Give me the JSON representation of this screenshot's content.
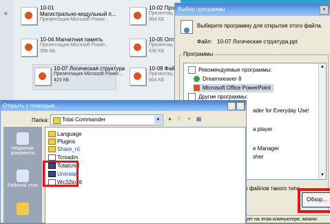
{
  "explorer": {
    "collapse_arrow": "«",
    "tiles": [
      {
        "name": "10-01",
        "line2": "Магистрально-модульный п...",
        "type": "Презентация Microsoft Power...",
        "size": ""
      },
      {
        "name": "10-02 Прои",
        "line2": "Презентац",
        "type": "964 КБ",
        "size": ""
      },
      {
        "name": "10-04 Магнитная память",
        "line2": "Презентация Microsoft Power...",
        "type": "356 КБ",
        "size": ""
      },
      {
        "name": "10-05 Опти",
        "line2": "Презентац",
        "type": "430 КБ",
        "size": ""
      },
      {
        "name": "10-07 Логическая структура",
        "line2": "Презентация Microsoft Power...",
        "type": "423 КБ",
        "size": ""
      },
      {
        "name": "10-08 Фай.",
        "line2": "Презентац",
        "type": "664 КБ",
        "size": ""
      }
    ],
    "more_label": "..."
  },
  "openwith": {
    "title": "Выбор программы",
    "close": "×",
    "prompt": "Выберите программу для открытия этого файла.",
    "file_label": "Файл:",
    "file_name": "10-07 Логическая структура.ppt",
    "group_label": "Программы",
    "items": [
      {
        "label": "Рекомендуемые программы:"
      },
      {
        "label": "Dreamweaver 8"
      },
      {
        "label": "Microsoft Office PowerPoint"
      },
      {
        "label": "Другие программы:"
      }
    ],
    "partial_items": [
      "ader for Everyday Use!",
      "a player",
      "e Manager",
      "sher"
    ],
    "checkbox_label": "к файлов такого типа",
    "browse_button": "Обзор...",
    "bottom_text": "твует на этом компьютере, можно"
  },
  "opendlg": {
    "title": "Открыть с помощью...",
    "help": "?",
    "close": "×",
    "lookin_label": "Папка:",
    "lookin_value": "Total Commander",
    "places": [
      {
        "label": "Недавние документы"
      },
      {
        "label": "Рабочий стол"
      },
      {
        "label": ""
      }
    ],
    "files": [
      {
        "name": "Language",
        "kind": "folder"
      },
      {
        "name": "Plugins",
        "kind": "folder"
      },
      {
        "name": "Share_nt",
        "kind": "folder"
      },
      {
        "name": "Tcmadm",
        "kind": "file"
      },
      {
        "name": "Totalcmd",
        "kind": "exe"
      },
      {
        "name": "Uninstall",
        "kind": "exe"
      },
      {
        "name": "Wc32to16",
        "kind": "file"
      }
    ]
  }
}
